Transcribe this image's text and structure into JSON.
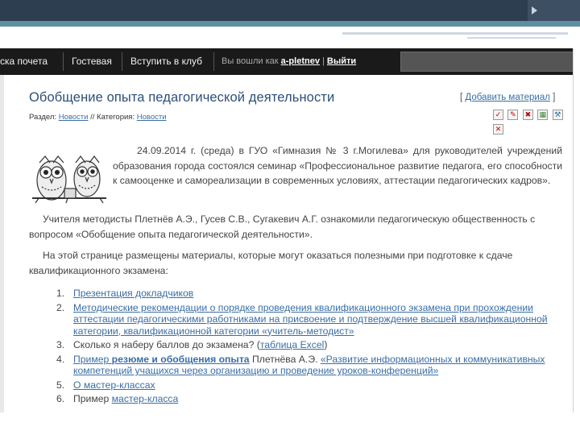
{
  "navbar": {
    "items": [
      "ска почета",
      "Гостевая",
      "Вступить в клуб"
    ],
    "status_prefix": "Вы вошли как",
    "user": "a-pletnev",
    "separator": "|",
    "logout": "Выйти"
  },
  "page": {
    "title": "Обобщение опыта педагогической деятельности",
    "add_material": {
      "open": "[",
      "label": "Добавить материал",
      "close": "]"
    },
    "breadcrumb": {
      "section_label": "Раздел:",
      "section_link": "Новости",
      "divider": "//",
      "category_label": "Категория:",
      "category_link": "Новости"
    },
    "tool_icons": [
      "red-check-icon",
      "edit-icon",
      "delete-icon",
      "chart-icon",
      "wrench-icon",
      "close-icon"
    ]
  },
  "content": {
    "p1": "24.09.2014 г. (среда) в ГУО «Гимназия № 3 г.Могилева» для руководителей учреждений образования города состоялся семинар «Профессиональное развитие педагога, его способности к самооценке и самореализации в современных условиях, аттестации педагогических кадров».",
    "p2": "Учителя методисты Плетнёв А.Э., Гусев С.В., Сугакевич А.Г. ознакомили педагогическую общественность с вопросом «Обобщение опыта педагогической деятельности».",
    "p3": "На этой странице размещены материалы, которые могут оказаться полезными при подготовке к сдаче квалификационного экзамена:",
    "list": [
      {
        "num": "1.",
        "link": "Презентация докладчиков"
      },
      {
        "num": "2.",
        "link": "Методические рекомендации о порядке проведения квалификационного экзамена при прохождении аттестации педагогическими работниками на присвоение и подтверждение высшей квалификационной категории, квалификационной категории «учитель-методист»"
      },
      {
        "num": "3.",
        "text": "Сколько я наберу баллов до экзамена? (",
        "link": "таблица Excel",
        "after": ")"
      },
      {
        "num": "4.",
        "link1": "Пример ",
        "link_bold": "резюме и обобщения опыта",
        "text": " Плетнёва А.Э. ",
        "link": "«Развитие информационных и коммуникативных компетенций учащихся через организацию и проведение уроков-конференций»"
      },
      {
        "num": "5.",
        "link": "О мастер-классах"
      },
      {
        "num": "6.",
        "text": "Пример ",
        "link": "мастер-класса"
      }
    ]
  }
}
